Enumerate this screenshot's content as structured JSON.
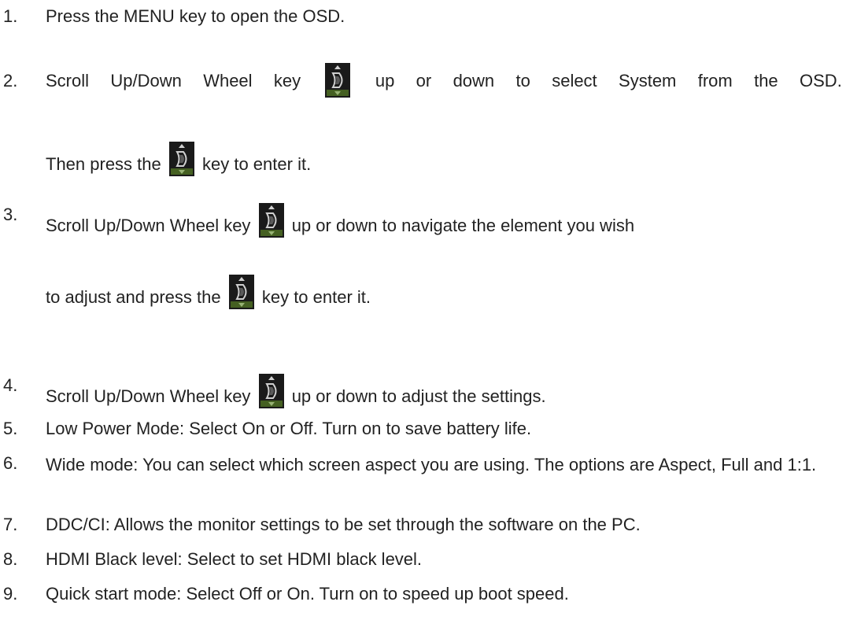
{
  "steps": [
    {
      "num": "1.",
      "text": "Press the MENU key to open the OSD."
    },
    {
      "num": "2.",
      "line1": [
        "Scroll",
        "Up/Down",
        "Wheel",
        "key",
        "up",
        "or",
        "down",
        "to",
        "select",
        "System",
        "from",
        "the",
        "OSD."
      ],
      "line2_pre": "Then press the",
      "line2_post": "key to enter it."
    },
    {
      "num": "3.",
      "line1_pre": "Scroll Up/Down Wheel key",
      "line1_post": "up or down to navigate the element you wish",
      "line2_pre": "to adjust and press the",
      "line2_post": "key to enter it."
    },
    {
      "num": "4.",
      "pre": "Scroll Up/Down Wheel key",
      "post": "up or down to adjust the settings."
    },
    {
      "num": "5.",
      "text": "Low Power Mode: Select On or Off. Turn on to save battery life."
    },
    {
      "num": "6.",
      "text": "Wide mode: You can select which screen aspect you are using. The options are Aspect, Full and 1:1."
    },
    {
      "num": "7.",
      "text": "DDC/CI: Allows the monitor settings to be set through the software on the PC."
    },
    {
      "num": "8.",
      "text": "HDMI Black level: Select to set HDMI black level."
    },
    {
      "num": "9.",
      "text": "Quick start mode: Select Off or On. Turn on to speed up boot speed."
    }
  ],
  "icons": {
    "wheel_key": "scroll-wheel-key-icon"
  },
  "colors": {
    "text": "#222222",
    "icon_bg": "#1a1a1a",
    "icon_fg": "#cfcfcf",
    "icon_accent": "#8fbf3a"
  }
}
